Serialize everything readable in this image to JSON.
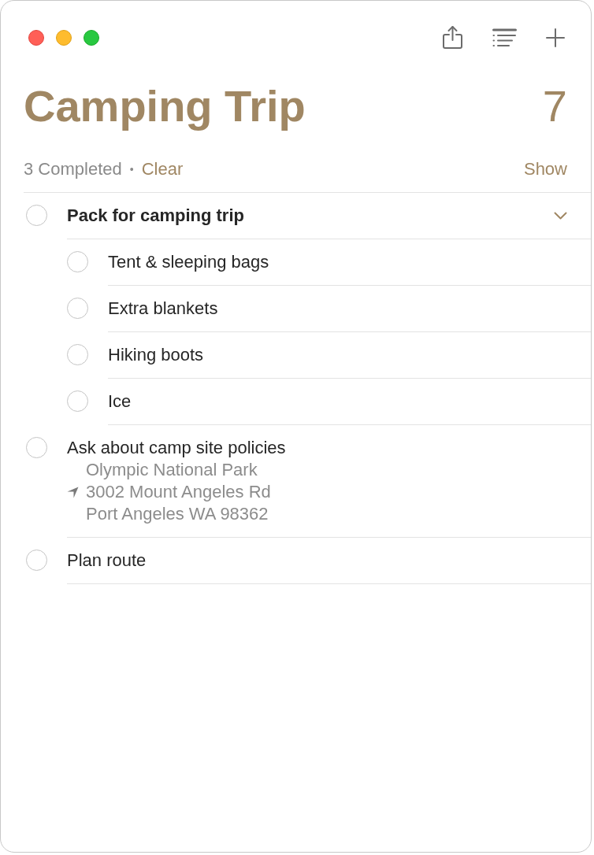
{
  "list": {
    "title": "Camping Trip",
    "count": "7"
  },
  "completed": {
    "label": "3 Completed",
    "bullet": "•",
    "clear": "Clear",
    "show": "Show"
  },
  "reminders": [
    {
      "title": "Pack for camping trip",
      "checked": false,
      "expanded": true,
      "children": [
        {
          "title": "Tent & sleeping bags",
          "checked": false
        },
        {
          "title": "Extra blankets",
          "checked": false
        },
        {
          "title": "Hiking boots",
          "checked": false
        },
        {
          "title": "Ice",
          "checked": false
        }
      ]
    },
    {
      "title": "Ask about camp site policies",
      "checked": false,
      "location": [
        "Olympic National Park",
        "3002 Mount Angeles Rd",
        "Port Angeles WA 98362"
      ]
    },
    {
      "title": "Plan route",
      "checked": false
    }
  ]
}
